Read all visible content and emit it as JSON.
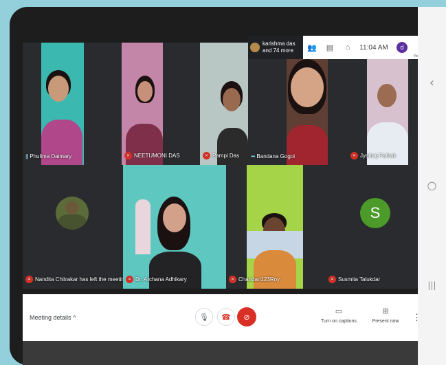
{
  "top_bar": {
    "participant_name": "karishma das",
    "participant_more": "and 74 more",
    "time": "11:04 AM",
    "you_initial": "d",
    "you_label": "You",
    "icons": [
      "people-icon",
      "chat-icon",
      "activities-icon"
    ]
  },
  "tiles": [
    {
      "name": "Phulima Daimary",
      "mic": "speaking"
    },
    {
      "name": "NEETUMONI DAS",
      "mic": "muted"
    },
    {
      "name": "Pampi Das",
      "mic": "muted"
    },
    {
      "name": "Bandana Gogoi",
      "mic": "speaking"
    },
    {
      "name": "Jyotiraj Pathak",
      "mic": "muted"
    },
    {
      "name": "Nandita Chitrakar has left the meeting",
      "mic": "muted"
    },
    {
      "name": "Dr. Archana Adhikary",
      "mic": "muted"
    },
    {
      "name": "Chandan123Roy",
      "mic": "muted"
    },
    {
      "name": "Susmita Talukdar",
      "mic": "muted",
      "avatar_letter": "S",
      "avatar_color": "#4c9a2a"
    }
  ],
  "bottom_bar": {
    "meeting_details": "Meeting details",
    "captions_label": "Turn on captions",
    "present_label": "Present now"
  },
  "nav": {
    "back": "‹",
    "home": "○",
    "recents": "|||"
  }
}
